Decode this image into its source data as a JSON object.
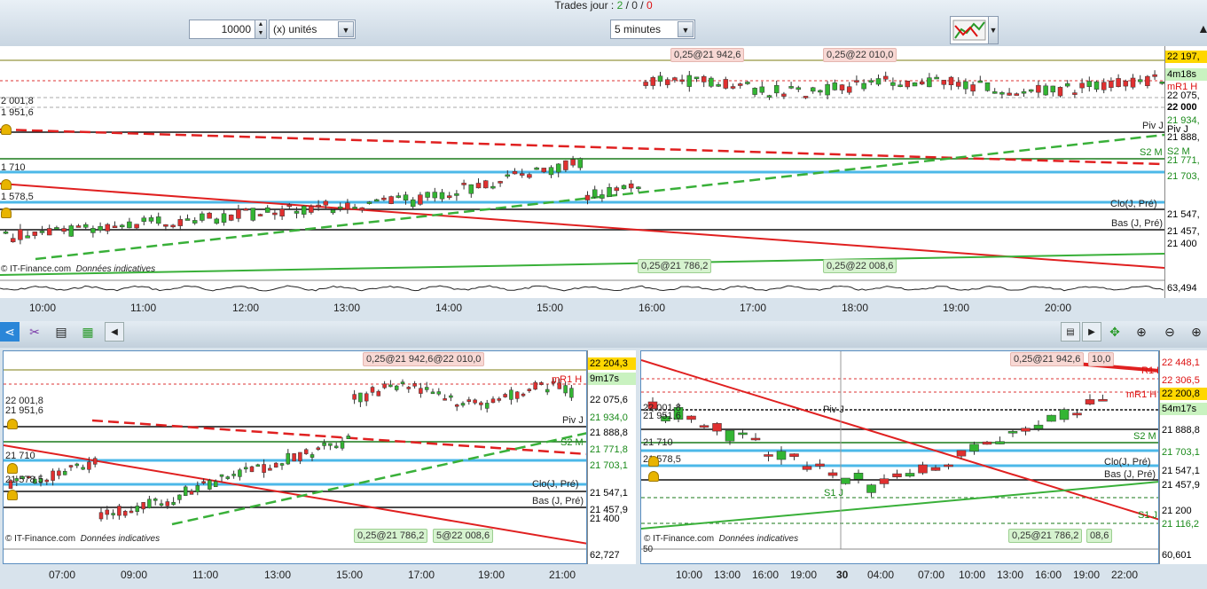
{
  "header": {
    "trades_label": "Trades jour : ",
    "t1": "2",
    "sep1": " / ",
    "t2": "0",
    "sep2": " / ",
    "t3": "0"
  },
  "controls": {
    "quantity": "10000",
    "units": "(x) unités",
    "timeframe": "5 minutes"
  },
  "main": {
    "price_labels": [
      {
        "text": "22 197,",
        "color": "#000",
        "bg": "#ffd700"
      },
      {
        "text": "4m18s",
        "color": "#000",
        "bg": "#c9f2c0"
      },
      {
        "text": "mR1 H",
        "color": "#d11"
      },
      {
        "text": "22 075,",
        "color": "#000"
      },
      {
        "text": "22 000",
        "color": "#000",
        "bold": true
      },
      {
        "text": "21 934,",
        "color": "#1a8a1a"
      },
      {
        "text": "Piv J",
        "color": "#000"
      },
      {
        "text": "21 888,",
        "color": "#000"
      },
      {
        "text": "S2 M",
        "color": "#1a8a1a"
      },
      {
        "text": "21 771,",
        "color": "#1a8a1a"
      },
      {
        "text": "21 703,",
        "color": "#1a8a1a"
      },
      {
        "text": "21 547,",
        "color": "#000"
      },
      {
        "text": "21 457,",
        "color": "#000"
      },
      {
        "text": "21 400",
        "color": "#000"
      },
      {
        "text": "63,494",
        "color": "#000"
      }
    ],
    "left_levels": [
      "2 001,8",
      "1 951,6",
      "1 710",
      "1 578,5"
    ],
    "line_labels": [
      "Piv J",
      "S2 M",
      "Bas (J, Pré)",
      "Clo(J, Pré)"
    ],
    "tags_top": [
      "0,25@21 942,6",
      "0,25@22 010,0"
    ],
    "tags_bottom": [
      "0,25@21 786,2",
      "0,25@22 008,6"
    ],
    "credit": "© IT-Finance.com",
    "credit_note": "Données indicatives",
    "times": [
      "10:00",
      "11:00",
      "12:00",
      "13:00",
      "14:00",
      "15:00",
      "16:00",
      "17:00",
      "18:00",
      "19:00",
      "20:00"
    ]
  },
  "toolbar": {
    "icons": [
      "share-icon",
      "scissors-icon",
      "settings-icon",
      "chart-style-icon",
      "scroll-left-icon",
      "menu-icon",
      "scroll-right-icon",
      "crosshair-icon",
      "zoom-fit-icon",
      "zoom-out-icon",
      "zoom-in-icon"
    ]
  },
  "bl": {
    "price_labels": [
      {
        "text": "22 204,3",
        "color": "#000",
        "bg": "#ffd700"
      },
      {
        "text": "9m17s",
        "color": "#000",
        "bg": "#c9f2c0"
      },
      {
        "text": "22 075,6",
        "color": "#000"
      },
      {
        "text": "21 934,0",
        "color": "#1a8a1a"
      },
      {
        "text": "21 888,8",
        "color": "#000"
      },
      {
        "text": "21 771,8",
        "color": "#1a8a1a"
      },
      {
        "text": "21 703,1",
        "color": "#1a8a1a"
      },
      {
        "text": "21 547,1",
        "color": "#000"
      },
      {
        "text": "21 457,9",
        "color": "#000"
      },
      {
        "text": "21 400",
        "color": "#000"
      },
      {
        "text": "62,727",
        "color": "#000"
      }
    ],
    "left_levels": [
      "22 001,8",
      "21 951,6",
      "21 710",
      "21 578,5"
    ],
    "tag_top": "0,25@21 942,6@22 010,0",
    "tag_bottom": "0,25@21 786,2",
    "tag_bottom2": "5@22 008,6",
    "line_labels": [
      "mR1 H",
      "Piv J",
      "S2 M",
      "Clo(J, Pré)",
      "Bas (J, Pré)"
    ],
    "credit": "© IT-Finance.com",
    "credit_note": "Données indicatives",
    "times": [
      "07:00",
      "09:00",
      "11:00",
      "13:00",
      "15:00",
      "17:00",
      "19:00",
      "21:00"
    ]
  },
  "br": {
    "price_labels": [
      {
        "text": "22 448,1",
        "color": "#d11"
      },
      {
        "text": "22 306,5",
        "color": "#d11"
      },
      {
        "text": "22 200,8",
        "color": "#000",
        "bg": "#ffd700"
      },
      {
        "text": "54m17s",
        "color": "#000",
        "bg": "#c9f2c0"
      },
      {
        "text": "21 888,8",
        "color": "#000"
      },
      {
        "text": "21 703,1",
        "color": "#1a8a1a"
      },
      {
        "text": "21 547,1",
        "color": "#000"
      },
      {
        "text": "21 457,9",
        "color": "#000"
      },
      {
        "text": "21 200",
        "color": "#000"
      },
      {
        "text": "21 116,2",
        "color": "#1a8a1a"
      },
      {
        "text": "60,601",
        "color": "#000"
      }
    ],
    "left_levels": [
      "22 001,8",
      "21 951,6",
      "21 710",
      "21 578,5"
    ],
    "tag_top": "0,25@21 942,6",
    "tag_top2": "10,0",
    "tag_bottom": "0,25@21 786,2",
    "tag_bottom2": "08,6",
    "line_labels": [
      "R1 H",
      "mR1 H",
      "Piv J",
      "S2 M",
      "Clo(J, Pré)",
      "Bas (J, Pré)",
      "S1 J",
      "S1 J"
    ],
    "credit": "© IT-Finance.com",
    "credit_note": "Données indicatives",
    "times": [
      "10:00",
      "13:00",
      "16:00",
      "19:00",
      "30",
      "04:00",
      "07:00",
      "10:00",
      "13:00",
      "16:00",
      "19:00",
      "22:00"
    ],
    "osc_label": "50"
  },
  "colors": {
    "up": "#33b533",
    "down": "#e03030",
    "blue_line": "#4cb8e8",
    "red_line": "#e02020",
    "green_line": "#39b039"
  }
}
